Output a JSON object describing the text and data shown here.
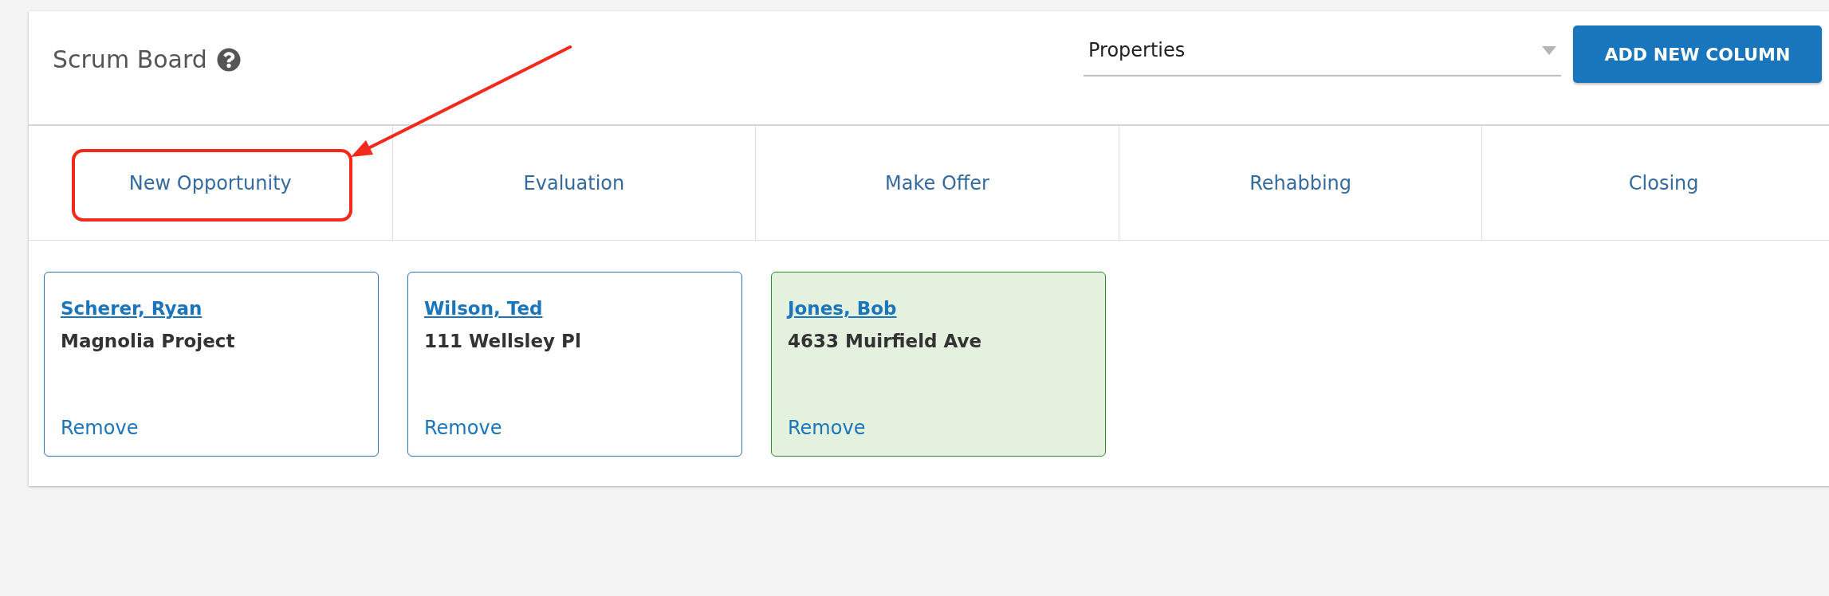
{
  "header": {
    "title": "Scrum Board",
    "property_select": {
      "value": "Properties"
    },
    "add_button": "ADD NEW COLUMN"
  },
  "columns": [
    {
      "label": "New Opportunity"
    },
    {
      "label": "Evaluation"
    },
    {
      "label": "Make Offer"
    },
    {
      "label": "Rehabbing"
    },
    {
      "label": "Closing"
    }
  ],
  "cards": [
    {
      "name": "Scherer, Ryan",
      "subtitle": "Magnolia Project",
      "action": "Remove",
      "selected": false
    },
    {
      "name": "Wilson, Ted",
      "subtitle": "111 Wellsley Pl",
      "action": "Remove",
      "selected": false
    },
    {
      "name": "Jones, Bob",
      "subtitle": "4633 Muirfield Ave",
      "action": "Remove",
      "selected": true
    }
  ]
}
